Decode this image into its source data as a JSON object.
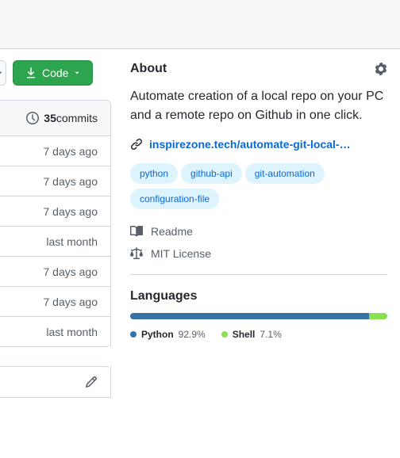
{
  "code_button_label": "Code",
  "commits": {
    "count": "35",
    "label": " commits"
  },
  "file_times": [
    "7 days ago",
    "7 days ago",
    "7 days ago",
    "last month",
    "7 days ago",
    "7 days ago",
    "last month"
  ],
  "about": {
    "heading": "About",
    "description": "Automate creation of a local repo on your PC and a remote repo on Github in one click.",
    "link_text": "inspirezone.tech/automate-git-local-…",
    "topics": [
      "python",
      "github-api",
      "git-automation",
      "configuration-file"
    ],
    "readme": "Readme",
    "license": "MIT License"
  },
  "languages": {
    "heading": "Languages",
    "items": [
      {
        "name": "Python",
        "pct": "92.9%",
        "color": "#3572A5",
        "width": "92.9%"
      },
      {
        "name": "Shell",
        "pct": "7.1%",
        "color": "#89e051",
        "width": "7.1%"
      }
    ]
  }
}
